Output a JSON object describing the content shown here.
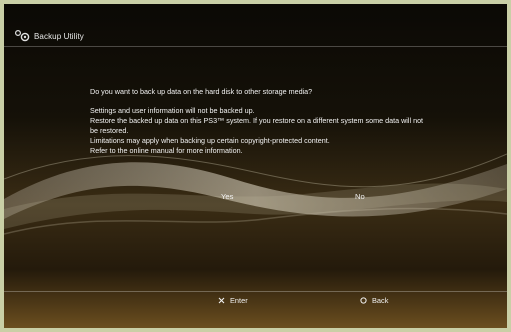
{
  "header": {
    "title": "Backup Utility",
    "icon": "backup-utility-icon"
  },
  "dialog": {
    "question": "Do you want to back up data on the hard disk to other storage media?",
    "lines": [
      "Settings and user information will not be backed up.",
      "Restore the backed up data on this PS3™ system. If you restore on a different system some data will not",
      "be restored.",
      "Limitations may apply when backing up certain copyright-protected content.",
      "Refer to the online manual for more information."
    ]
  },
  "buttons": {
    "yes_label": "Yes",
    "no_label": "No"
  },
  "footer": {
    "enter_label": "Enter",
    "back_label": "Back",
    "enter_icon": "cross-icon",
    "back_icon": "circle-icon"
  },
  "colors": {
    "text": "#f2f2f2",
    "frame": "#c9cfa6",
    "background": "#0b0905",
    "wave": "#d8d0b8"
  }
}
